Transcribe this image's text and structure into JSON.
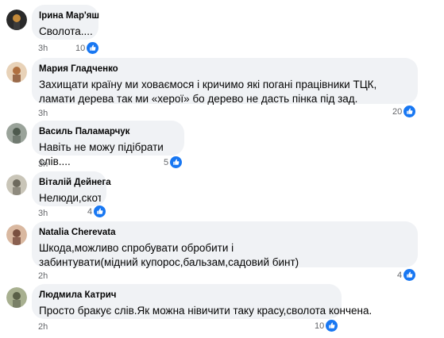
{
  "comments": [
    {
      "author": "Ірина Мар'яш",
      "text": "Сволота....",
      "time": "3h",
      "likes": "10",
      "avatar_colors": [
        "#2a2a2a",
        "#c48a3a"
      ]
    },
    {
      "author": "Мария Гладченко",
      "text": "Захищати країну ми ховаємося і кричимо які погані працівники ТЦК, ламати дерева так ми «херої» бо дерево не дасть пінка під зад.",
      "time": "3h",
      "likes": "20",
      "avatar_colors": [
        "#e8d2b8",
        "#b07040"
      ]
    },
    {
      "author": "Василь Паламарчук",
      "text": "Навіть не можу підібрати слів....",
      "time": "3h",
      "likes": "5",
      "avatar_colors": [
        "#9aa39a",
        "#4e5a4e"
      ]
    },
    {
      "author": "Віталій Дейнега",
      "text": "Нелюди,скоти",
      "time": "3h",
      "likes": "4",
      "avatar_colors": [
        "#c9c5b8",
        "#6e6a5e"
      ]
    },
    {
      "author": "Natalia Cherevata",
      "text": "Шкода,можливо спробувати обробити і забинтувати(мідний купорос,бальзам,садовий бинт)",
      "time": "2h",
      "likes": "4",
      "avatar_colors": [
        "#7a5040",
        "#d9b8a0"
      ]
    },
    {
      "author": "Людмила Катрич",
      "text": "Просто бракує слів.Як можна нівичити таку красу,сволота кончена.",
      "time": "2h",
      "likes": "10",
      "avatar_colors": [
        "#a8b090",
        "#5a6048"
      ]
    }
  ],
  "colors": {
    "bubble_bg": "#f0f2f5",
    "like_blue": "#1877f2",
    "meta_gray": "#65676b"
  },
  "icons": {
    "reaction": "like-icon"
  }
}
